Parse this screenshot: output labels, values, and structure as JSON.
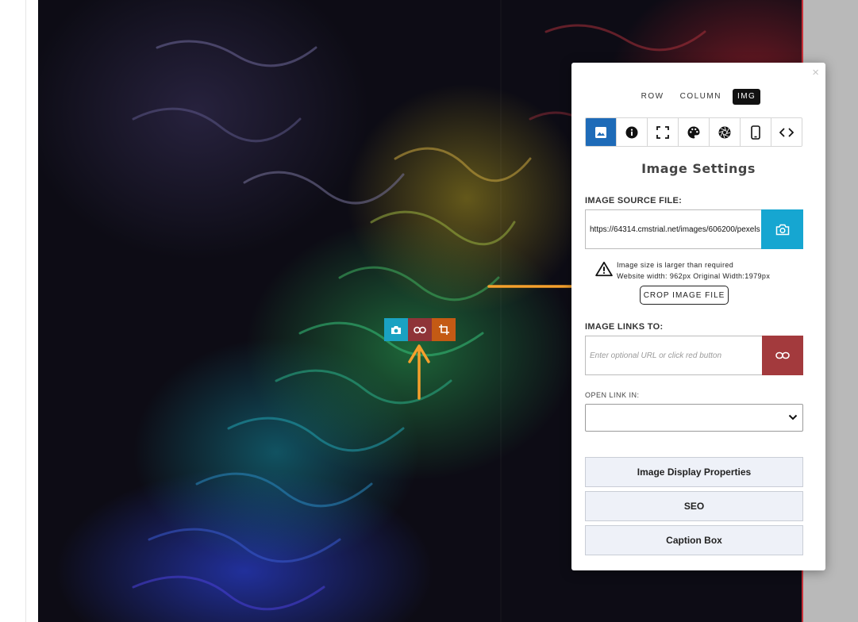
{
  "canvas_toolbar": {
    "camera_icon": "camera-icon",
    "link_icon": "link-icon",
    "crop_icon": "crop-icon"
  },
  "annotations": {
    "arrow_color": "#f5a02c"
  },
  "panel": {
    "close_label": "×",
    "level_tabs": [
      {
        "label": "ROW",
        "active": false
      },
      {
        "label": "COLUMN",
        "active": false
      },
      {
        "label": "IMG",
        "active": true
      }
    ],
    "icon_tabs": [
      {
        "icon": "image-icon",
        "active": true
      },
      {
        "icon": "info-icon",
        "active": false
      },
      {
        "icon": "fullscreen-icon",
        "active": false
      },
      {
        "icon": "palette-icon",
        "active": false
      },
      {
        "icon": "aperture-icon",
        "active": false
      },
      {
        "icon": "mobile-icon",
        "active": false
      },
      {
        "icon": "code-icon",
        "active": false
      }
    ],
    "title": "Image Settings",
    "source": {
      "label": "IMAGE SOURCE FILE:",
      "value": "https://64314.cmstrial.net/images/606200/pexels",
      "button_icon": "camera-icon"
    },
    "warning": {
      "icon": "warning-icon",
      "line1": "Image size is larger than required",
      "line2": "Website width: 962px Original Width:1979px"
    },
    "crop_button": "CROP IMAGE FILE",
    "links": {
      "label": "IMAGE LINKS TO:",
      "placeholder": "Enter optional URL or click red button",
      "button_icon": "link-icon"
    },
    "open_link": {
      "label": "OPEN LINK IN:",
      "value": ""
    },
    "accordions": [
      "Image Display Properties",
      "SEO",
      "Caption Box"
    ]
  },
  "colors": {
    "active_tab": "#1e6bb8",
    "camera_button": "#16a6d1",
    "link_button": "#a33a3d",
    "crop_toolbar_button": "#c45a14"
  }
}
